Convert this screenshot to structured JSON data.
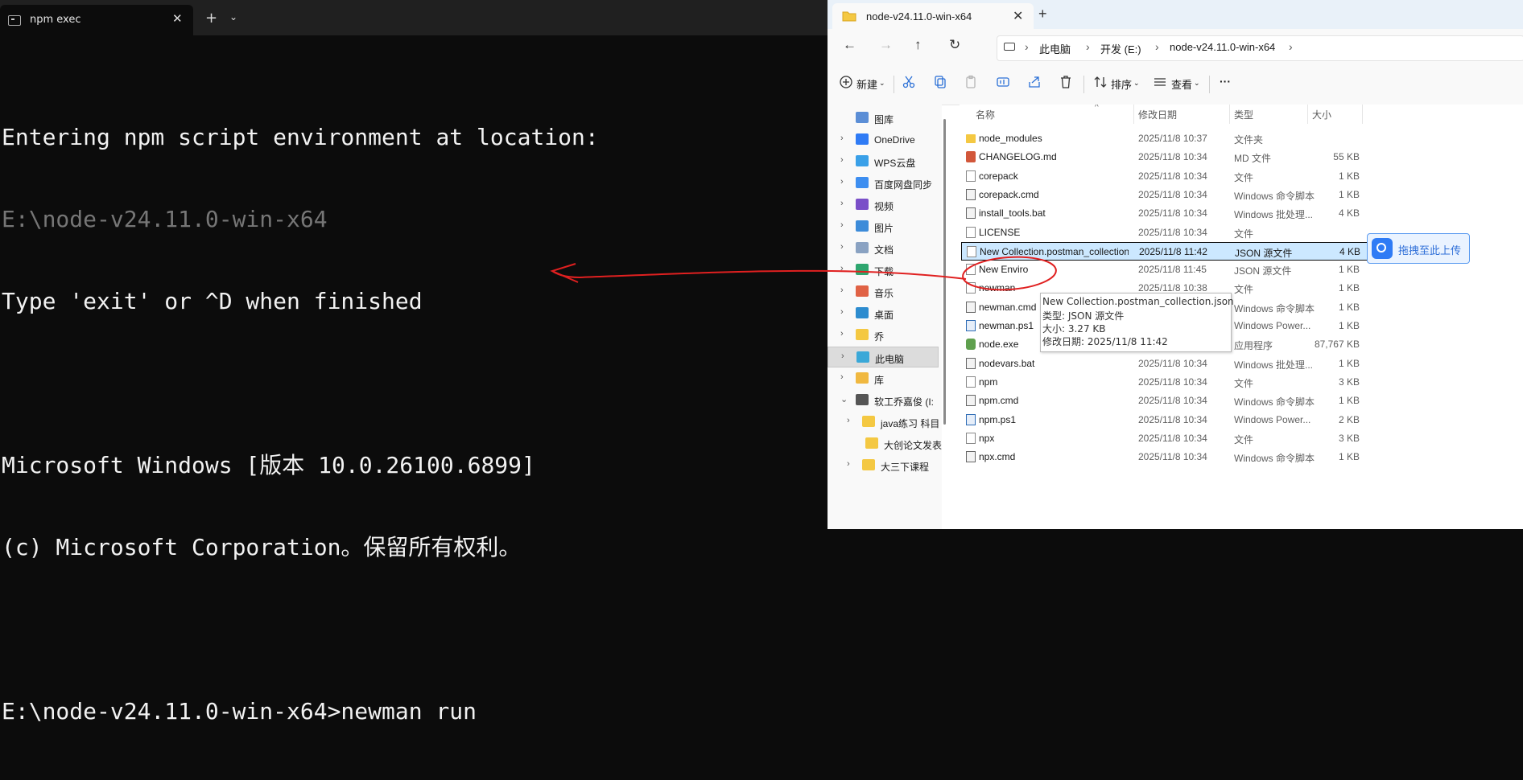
{
  "terminal": {
    "tab_title": "npm exec",
    "close_glyph": "✕",
    "new_tab_glyph": "+",
    "dropdown_glyph": "⌄",
    "lines": [
      "Entering npm script environment at location:",
      "E:\\node-v24.11.0-win-x64",
      "Type 'exit' or ^D when finished",
      "",
      "Microsoft Windows [版本 10.0.26100.6899]",
      "(c) Microsoft Corporation。保留所有权利。",
      "",
      "E:\\node-v24.11.0-win-x64>newman run"
    ]
  },
  "explorer": {
    "tab_title": "node-v24.11.0-win-x64",
    "close_glyph": "✕",
    "new_tab_glyph": "+",
    "nav": {
      "back": "←",
      "forward": "→",
      "up": "↑",
      "refresh": "↻"
    },
    "breadcrumb": [
      "此电脑",
      "开发 (E:)",
      "node-v24.11.0-win-x64"
    ],
    "breadcrumb_sep": "›",
    "commands": {
      "new": "新建",
      "sort": "排序",
      "view": "查看",
      "more": "···"
    },
    "nav_pane": [
      {
        "label": "图库",
        "icon": "gallery-icon",
        "chev": ""
      },
      {
        "label": "OneDrive",
        "icon": "onedrive-icon",
        "chev": "›"
      },
      {
        "label": "WPS云盘",
        "icon": "wps-cloud-icon",
        "chev": "›"
      },
      {
        "label": "百度网盘同步",
        "icon": "baidu-netdisk-icon",
        "chev": "›"
      },
      {
        "label": "视频",
        "icon": "video-icon",
        "chev": "›"
      },
      {
        "label": "图片",
        "icon": "pictures-icon",
        "chev": "›"
      },
      {
        "label": "文档",
        "icon": "documents-icon",
        "chev": "›"
      },
      {
        "label": "下载",
        "icon": "downloads-icon",
        "chev": "›"
      },
      {
        "label": "音乐",
        "icon": "music-icon",
        "chev": "›"
      },
      {
        "label": "桌面",
        "icon": "desktop-icon",
        "chev": "›"
      },
      {
        "label": "乔",
        "icon": "folder-icon",
        "chev": "›"
      },
      {
        "label": "此电脑",
        "icon": "this-pc-icon",
        "chev": "›"
      },
      {
        "label": "库",
        "icon": "library-icon",
        "chev": "›"
      },
      {
        "label": "软工乔嘉俊 (I:",
        "icon": "drive-icon",
        "chev": "⌄"
      },
      {
        "label": "java练习 科目",
        "icon": "folder-icon",
        "chev": "›"
      },
      {
        "label": "大创论文发表",
        "icon": "folder-icon",
        "chev": ""
      },
      {
        "label": "大三下课程",
        "icon": "folder-icon",
        "chev": "›"
      }
    ],
    "columns": {
      "name": "名称",
      "date": "修改日期",
      "type": "类型",
      "size": "大小",
      "sort_glyph": "^"
    },
    "files": [
      {
        "name": "node_modules",
        "date": "2025/11/8 10:37",
        "type": "文件夹",
        "size": "",
        "icon": "folder"
      },
      {
        "name": "CHANGELOG.md",
        "date": "2025/11/8 10:34",
        "type": "MD 文件",
        "size": "55 KB",
        "icon": "md"
      },
      {
        "name": "corepack",
        "date": "2025/11/8 10:34",
        "type": "文件",
        "size": "1 KB",
        "icon": "file"
      },
      {
        "name": "corepack.cmd",
        "date": "2025/11/8 10:34",
        "type": "Windows 命令脚本",
        "size": "1 KB",
        "icon": "script"
      },
      {
        "name": "install_tools.bat",
        "date": "2025/11/8 10:34",
        "type": "Windows 批处理...",
        "size": "4 KB",
        "icon": "script"
      },
      {
        "name": "LICENSE",
        "date": "2025/11/8 10:34",
        "type": "文件",
        "size": "",
        "icon": "file"
      },
      {
        "name": "New Collection.postman_collection.js...",
        "date": "2025/11/8 11:42",
        "type": "JSON 源文件",
        "size": "4 KB",
        "icon": "file"
      },
      {
        "name": "New Enviro",
        "date": "2025/11/8 11:45",
        "type": "JSON 源文件",
        "size": "1 KB",
        "icon": "file"
      },
      {
        "name": "newman",
        "date": "2025/11/8 10:38",
        "type": "文件",
        "size": "1 KB",
        "icon": "file"
      },
      {
        "name": "newman.cmd",
        "date": "2025/11/8 10:38",
        "type": "Windows 命令脚本",
        "size": "1 KB",
        "icon": "script"
      },
      {
        "name": "newman.ps1",
        "date": "2025/11/8 10:38",
        "type": "Windows Power...",
        "size": "1 KB",
        "icon": "ps"
      },
      {
        "name": "node.exe",
        "date": "2025/11/8 10:34",
        "type": "应用程序",
        "size": "87,767 KB",
        "icon": "node"
      },
      {
        "name": "nodevars.bat",
        "date": "2025/11/8 10:34",
        "type": "Windows 批处理...",
        "size": "1 KB",
        "icon": "script"
      },
      {
        "name": "npm",
        "date": "2025/11/8 10:34",
        "type": "文件",
        "size": "3 KB",
        "icon": "file"
      },
      {
        "name": "npm.cmd",
        "date": "2025/11/8 10:34",
        "type": "Windows 命令脚本",
        "size": "1 KB",
        "icon": "script"
      },
      {
        "name": "npm.ps1",
        "date": "2025/11/8 10:34",
        "type": "Windows Power...",
        "size": "2 KB",
        "icon": "ps"
      },
      {
        "name": "npx",
        "date": "2025/11/8 10:34",
        "type": "文件",
        "size": "3 KB",
        "icon": "file"
      },
      {
        "name": "npx.cmd",
        "date": "2025/11/8 10:34",
        "type": "Windows 命令脚本",
        "size": "1 KB",
        "icon": "script"
      }
    ],
    "selected_index": 6,
    "tooltip": {
      "line1": "New Collection.postman_collection.json",
      "line2": "类型: JSON 源文件",
      "line3": "大小: 3.27 KB",
      "line4": "修改日期: 2025/11/8 11:42"
    },
    "upload_label": "拖拽至此上传"
  },
  "colors": {
    "annotation": "#e02020",
    "selection": "#cce8ff",
    "terminal_bg": "#0c0c0c"
  }
}
